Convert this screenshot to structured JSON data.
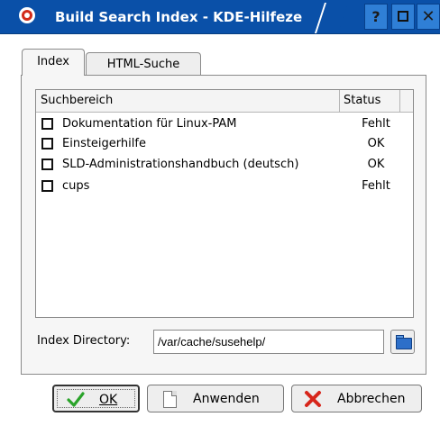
{
  "window": {
    "title": "Build Search Index - KDE-Hilfeze",
    "help_label": "?",
    "close_label": "✕"
  },
  "tabs": [
    {
      "label": "Index",
      "active": true
    },
    {
      "label": "HTML-Suche",
      "active": false
    }
  ],
  "table": {
    "columns": [
      "Suchbereich",
      "Status"
    ],
    "rows": [
      {
        "name": "Dokumentation für Linux-PAM",
        "status": "Fehlt",
        "checked": false
      },
      {
        "name": "Einsteigerhilfe",
        "status": "OK",
        "checked": false
      },
      {
        "name": "SLD-Administrationshandbuch (deutsch)",
        "status": "OK",
        "checked": false
      },
      {
        "name": "cups",
        "status": "Fehlt",
        "checked": false
      }
    ]
  },
  "index_directory": {
    "label": "Index Directory:",
    "value": "/var/cache/susehelp/"
  },
  "buttons": {
    "ok": "OK",
    "apply": "Anwenden",
    "cancel": "Abbrechen"
  },
  "colors": {
    "titlebar": "#0a50a8",
    "ok_check": "#2aa32a",
    "cancel_x": "#d7261b"
  },
  "icons": {
    "app": "help-lifebuoy-icon",
    "folder": "folder-open-icon",
    "ok": "check-icon",
    "apply": "document-icon",
    "cancel": "cancel-x-icon"
  }
}
